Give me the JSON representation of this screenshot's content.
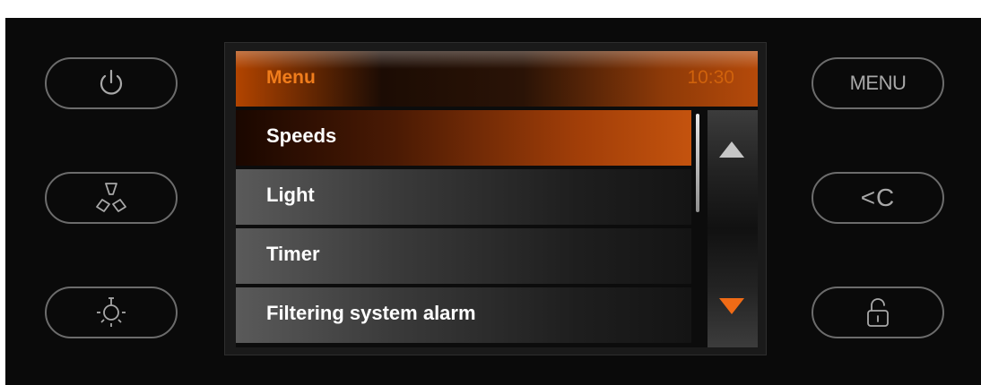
{
  "header": {
    "title": "Menu",
    "time": "10:30"
  },
  "menu": {
    "items": [
      {
        "label": "Speeds",
        "selected": true
      },
      {
        "label": "Light",
        "selected": false
      },
      {
        "label": "Timer",
        "selected": false
      },
      {
        "label": "Filtering system alarm",
        "selected": false
      }
    ]
  },
  "buttons": {
    "left": [
      {
        "name": "power",
        "icon": "power-icon"
      },
      {
        "name": "fan",
        "icon": "fan-icon"
      },
      {
        "name": "light",
        "icon": "light-bulb-icon"
      }
    ],
    "right": [
      {
        "name": "menu",
        "label": "MENU"
      },
      {
        "name": "back",
        "label": "<C",
        "icon": "back-clear-icon"
      },
      {
        "name": "lock",
        "icon": "lock-icon"
      }
    ]
  },
  "colors": {
    "accent": "#f07d1c",
    "selected_bg": "#c4530e",
    "arrow_down": "#f06b16",
    "panel": "#0a0a0a"
  },
  "scrollbar": {
    "up_icon": "triangle-up-icon",
    "down_icon": "triangle-down-icon"
  }
}
